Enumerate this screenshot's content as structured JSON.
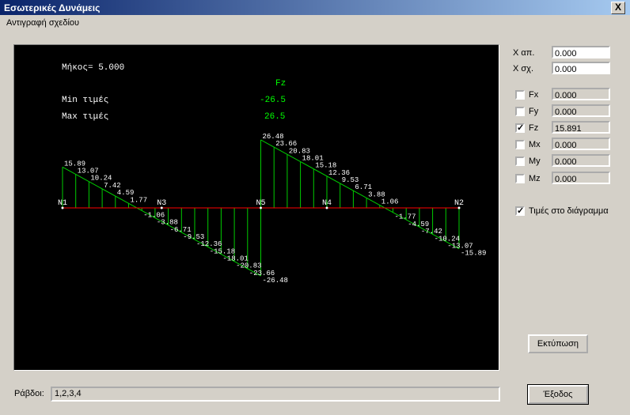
{
  "window": {
    "title": "Εσωτερικές Δυνάμεις",
    "close_glyph": "X"
  },
  "menu": {
    "copy_diagram": "Αντιγραφή σχεδίου"
  },
  "diagram": {
    "length_label": "Μήκος= 5.000",
    "component": "Fz",
    "min_label": "Min τιμές",
    "min_value": "-26.5",
    "max_label": "Max τιμές",
    "max_value": "26.5",
    "colors": {
      "axis": "#ff0000",
      "fill": "#00cc00",
      "text": "#ffffff",
      "values": "#00ff00"
    },
    "nodes": [
      {
        "name": "N1",
        "pos": 0
      },
      {
        "name": "N3",
        "pos": 1.25
      },
      {
        "name": "N5",
        "pos": 2.5
      },
      {
        "name": "N4",
        "pos": 3.333
      },
      {
        "name": "N2",
        "pos": 5.0
      }
    ],
    "chart_data": {
      "type": "line",
      "title": "Fz",
      "x": [
        0,
        2.5,
        2.5,
        5.0
      ],
      "y": [
        15.89,
        -26.48,
        26.48,
        -15.89
      ],
      "labels_left_start": [
        "15.89",
        "13.07",
        "10.24",
        "7.42",
        "4.59",
        "1.77",
        "-1.06",
        "-3.88",
        "-6.71",
        "-9.53",
        "-12.36",
        "-15.18",
        "-18.01",
        "-20.83",
        "-23.66",
        "-26.48"
      ],
      "labels_right_start": [
        "26.48",
        "23.66",
        "20.83",
        "18.01",
        "15.18",
        "12.36",
        "9.53",
        "6.71",
        "3.88",
        "1.06",
        "-1.77",
        "-4.59",
        "-7.42",
        "-10.24",
        "-13.07",
        "-15.89"
      ]
    }
  },
  "controls": {
    "x_start_label": "Χ απ.",
    "x_start_value": "0.000",
    "x_end_label": "Χ σχ.",
    "x_end_value": "0.000",
    "components": [
      {
        "label": "Fx",
        "value": "0.000",
        "checked": false
      },
      {
        "label": "Fy",
        "value": "0.000",
        "checked": false
      },
      {
        "label": "Fz",
        "value": "15.891",
        "checked": true
      },
      {
        "label": "Mx",
        "value": "0.000",
        "checked": false
      },
      {
        "label": "My",
        "value": "0.000",
        "checked": false
      },
      {
        "label": "Mz",
        "value": "0.000",
        "checked": false
      }
    ],
    "show_values_label": "Τιμές στο διάγραμμα",
    "show_values_checked": true,
    "print_button": "Εκτύπωση",
    "exit_button": "Έξοδος"
  },
  "footer": {
    "members_label": "Ράβδοι:",
    "members_value": "1,2,3,4"
  }
}
